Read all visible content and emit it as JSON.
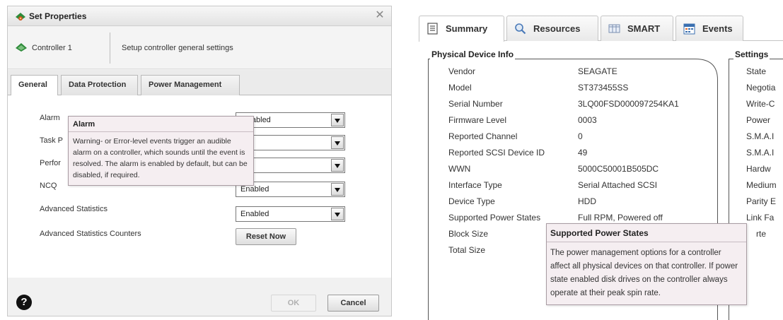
{
  "dialog": {
    "title": "Set Properties",
    "close_symbol": "✕",
    "controller_name": "Controller 1",
    "subtitle": "Setup controller general settings",
    "tabs": [
      {
        "label": "General",
        "active": true
      },
      {
        "label": "Data Protection",
        "active": false
      },
      {
        "label": "Power Management",
        "active": false
      }
    ],
    "settings": [
      {
        "label": "Alarm",
        "value": "Disabled"
      },
      {
        "label": "Task P",
        "value": "um"
      },
      {
        "label": "Perfor",
        "value": "mic"
      },
      {
        "label": "NCQ",
        "value": "Enabled"
      },
      {
        "label": "Advanced Statistics",
        "value": "Enabled"
      },
      {
        "label": "Advanced Statistics Counters"
      }
    ],
    "reset_label": "Reset Now",
    "alarm_tooltip": {
      "title": "Alarm",
      "text": "Warning- or Error-level events trigger an audible alarm on a controller, which sounds until the event is resolved. The alarm is enabled by default, but can be disabled, if required."
    },
    "help_symbol": "?",
    "ok_label": "OK",
    "cancel_label": "Cancel"
  },
  "panel": {
    "tabs": [
      {
        "label": "Summary",
        "icon": "document-icon",
        "active": true
      },
      {
        "label": "Resources",
        "icon": "magnifier-icon",
        "active": false
      },
      {
        "label": "SMART",
        "icon": "table-icon",
        "active": false
      },
      {
        "label": "Events",
        "icon": "calendar-icon",
        "active": false
      }
    ],
    "physical_device_info": {
      "title": "Physical Device Info",
      "rows": [
        {
          "label": "Vendor",
          "value": "SEAGATE"
        },
        {
          "label": "Model",
          "value": "ST373455SS"
        },
        {
          "label": "Serial Number",
          "value": "3LQ00FSD000097254KA1"
        },
        {
          "label": "Firmware Level",
          "value": "0003"
        },
        {
          "label": "Reported Channel",
          "value": "0"
        },
        {
          "label": "Reported SCSI Device ID",
          "value": "49"
        },
        {
          "label": "WWN",
          "value": "5000C50001B505DC"
        },
        {
          "label": "Interface Type",
          "value": "Serial Attached SCSI"
        },
        {
          "label": "Device Type",
          "value": "HDD"
        },
        {
          "label": "Supported Power States",
          "value": "Full RPM, Powered off"
        },
        {
          "label": "Block Size",
          "value": ""
        },
        {
          "label": "Total Size",
          "value": ""
        }
      ]
    },
    "settings": {
      "title": "Settings",
      "labels": [
        "State",
        "Negotia",
        "Write-C",
        "Power",
        "S.M.A.I",
        "S.M.A.I",
        "Hardw",
        "Medium",
        "Parity E",
        "Link Fa",
        "rte"
      ]
    },
    "tooltip": {
      "title": "Supported Power States",
      "text": "The power management options for a controller affect all physical devices on that controller. If power state enabled disk drives on the controller always operate at their peak spin rate."
    }
  },
  "colors": {
    "tooltip_bg": "#f5eef1",
    "tooltip_border": "#a99ca3",
    "icon_green": "#2e8b3a",
    "icon_blue": "#3a6fb0"
  }
}
